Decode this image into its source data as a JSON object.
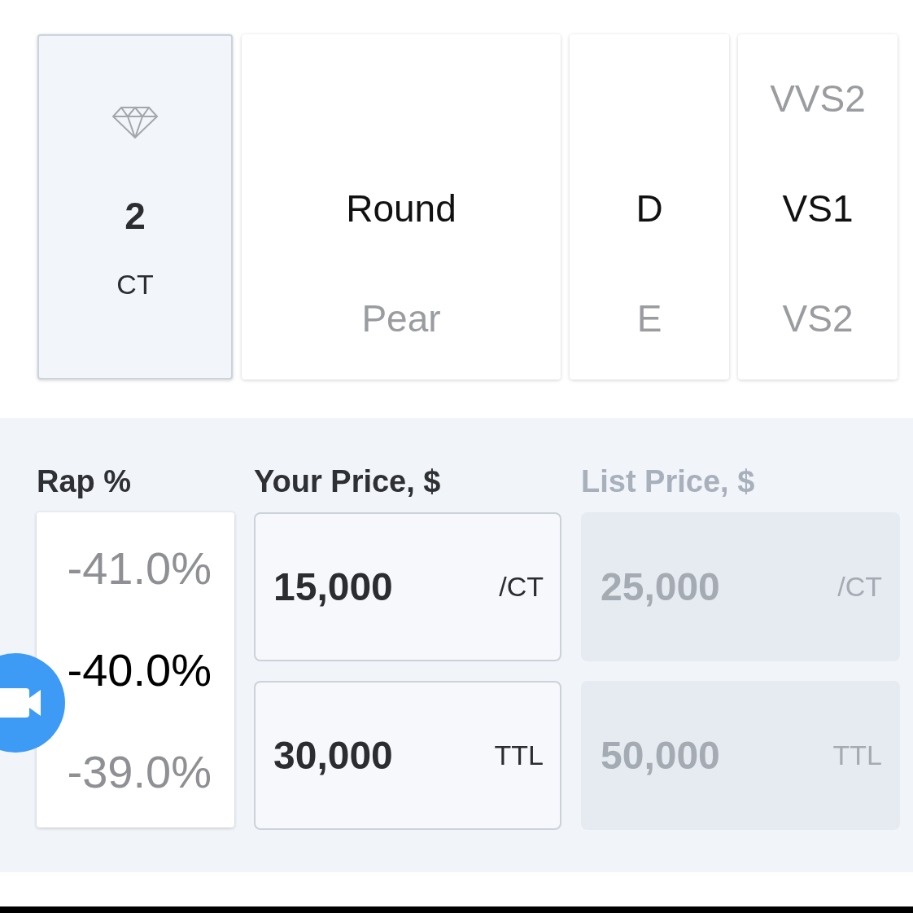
{
  "carat": {
    "value": "2",
    "unit": "CT",
    "selected": true
  },
  "wheels": [
    {
      "items": [
        {
          "label": "Round",
          "selected": true
        },
        {
          "label": "Pear",
          "selected": false
        }
      ]
    },
    {
      "items": [
        {
          "label": "D",
          "selected": true
        },
        {
          "label": "E",
          "selected": false
        }
      ]
    },
    {
      "items": [
        {
          "label": "VVS2",
          "selected": false
        },
        {
          "label": "VS1",
          "selected": true
        },
        {
          "label": "VS2",
          "selected": false
        }
      ]
    }
  ],
  "rap": {
    "label": "Rap %",
    "items": [
      {
        "label": "-41.0%",
        "selected": false
      },
      {
        "label": "-40.0%",
        "selected": true
      },
      {
        "label": "-39.0%",
        "selected": false
      }
    ]
  },
  "prices": [
    {
      "label": "Your Price, $",
      "disabled": false,
      "fields": [
        {
          "value": "15,000",
          "unit": "/CT"
        },
        {
          "value": "30,000",
          "unit": "TTL"
        }
      ]
    },
    {
      "label": "List Price, $",
      "disabled": true,
      "fields": [
        {
          "value": "25,000",
          "unit": "/CT"
        },
        {
          "value": "50,000",
          "unit": "TTL"
        }
      ]
    }
  ]
}
